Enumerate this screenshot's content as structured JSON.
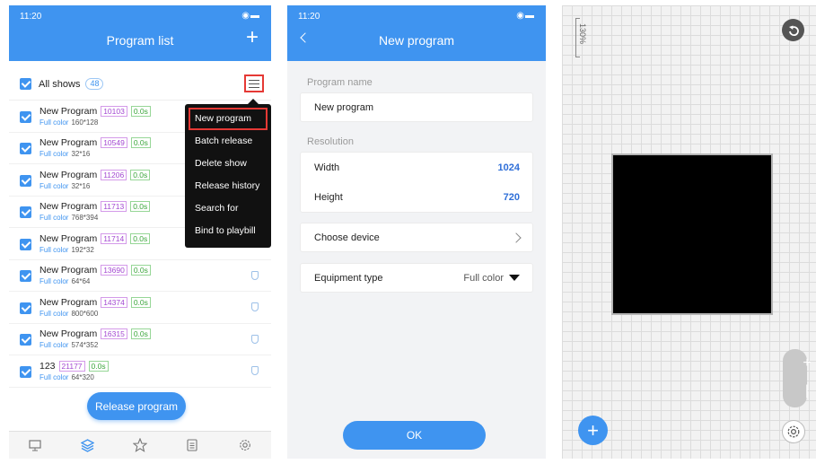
{
  "colors": {
    "primary": "#3f94f0",
    "highlight": "#e53935",
    "tag_id": "#a347d1",
    "tag_duration": "#3aa53a"
  },
  "screen1": {
    "status_time": "11:20",
    "title": "Program list",
    "all_shows_label": "All shows",
    "all_shows_count": "48",
    "programs": [
      {
        "name": "New Program",
        "id": "10103",
        "duration": "0.0s",
        "color": "Full color",
        "resolution": "160*128"
      },
      {
        "name": "New Program",
        "id": "10549",
        "duration": "0.0s",
        "color": "Full color",
        "resolution": "32*16"
      },
      {
        "name": "New Program",
        "id": "11206",
        "duration": "0.0s",
        "color": "Full color",
        "resolution": "32*16"
      },
      {
        "name": "New Program",
        "id": "11713",
        "duration": "0.0s",
        "color": "Full color",
        "resolution": "768*394"
      },
      {
        "name": "New Program",
        "id": "11714",
        "duration": "0.0s",
        "color": "Full color",
        "resolution": "192*32"
      },
      {
        "name": "New Program",
        "id": "13690",
        "duration": "0.0s",
        "color": "Full color",
        "resolution": "64*64"
      },
      {
        "name": "New Program",
        "id": "14374",
        "duration": "0.0s",
        "color": "Full color",
        "resolution": "800*600"
      },
      {
        "name": "New Program",
        "id": "16315",
        "duration": "0.0s",
        "color": "Full color",
        "resolution": "574*352"
      },
      {
        "name": "123",
        "id": "21177",
        "duration": "0.0s",
        "color": "Full color",
        "resolution": "64*320"
      }
    ],
    "menu": [
      "New program",
      "Batch release",
      "Delete show",
      "Release history",
      "Search for",
      "Bind to playbill"
    ],
    "release_button": "Release program",
    "tabs": [
      "monitor-icon",
      "layers-icon",
      "star-icon",
      "list-icon",
      "gear-icon"
    ]
  },
  "screen2": {
    "status_time": "11:20",
    "title": "New program",
    "program_name_label": "Program name",
    "program_name_value": "New program",
    "resolution_label": "Resolution",
    "width_label": "Width",
    "width_value": "1024",
    "height_label": "Height",
    "height_value": "720",
    "choose_device_label": "Choose device",
    "equipment_type_label": "Equipment type",
    "equipment_type_value": "Full color",
    "ok_button": "OK"
  },
  "screen3": {
    "zoom_level": "130%"
  }
}
